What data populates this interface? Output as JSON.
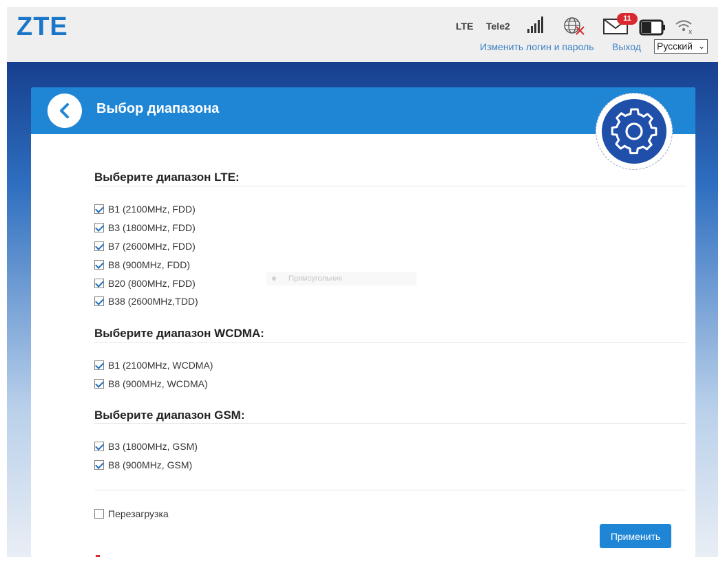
{
  "header": {
    "logo": "ZTE",
    "network_type": "LTE",
    "operator": "Tele2",
    "message_count": "11",
    "change_login_link": "Изменить логин и пароль",
    "logout_link": "Выход",
    "language_selected": "Русский"
  },
  "page": {
    "title": "Выбор диапазона"
  },
  "lte": {
    "title": "Выберите диапазон LTE:",
    "items": [
      {
        "label": "B1 (2100MHz, FDD)",
        "checked": true
      },
      {
        "label": "B3 (1800MHz, FDD)",
        "checked": true
      },
      {
        "label": "B7 (2600MHz, FDD)",
        "checked": true
      },
      {
        "label": "B8 (900MHz, FDD)",
        "checked": true
      },
      {
        "label": "B20 (800MHz, FDD)",
        "checked": true
      },
      {
        "label": "B38 (2600MHz,TDD)",
        "checked": true
      }
    ]
  },
  "wcdma": {
    "title": "Выберите диапазон WCDMA:",
    "items": [
      {
        "label": "B1 (2100MHz, WCDMA)",
        "checked": true
      },
      {
        "label": "B8 (900MHz, WCDMA)",
        "checked": true
      }
    ]
  },
  "gsm": {
    "title": "Выберите диапазон GSM:",
    "items": [
      {
        "label": "B3 (1800MHz, GSM)",
        "checked": true
      },
      {
        "label": "B8 (900MHz, GSM)",
        "checked": true
      }
    ]
  },
  "reboot": {
    "label": "Перезагрузка",
    "checked": false
  },
  "apply_label": "Применить",
  "ghost_label": "Прямоугольник",
  "colors": {
    "accent": "#1f86d6",
    "header_bg": "#efefef",
    "badge": "#d9292f",
    "gear_bg": "#1f4fa8"
  },
  "icons": [
    "back-arrow-icon",
    "gear-icon",
    "signal-icon",
    "globe-disconnected-icon",
    "mail-icon",
    "battery-icon",
    "wifi-off-icon"
  ]
}
